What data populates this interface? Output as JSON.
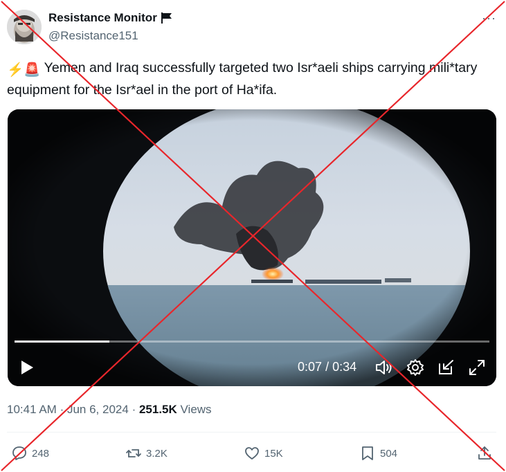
{
  "author": {
    "display_name": "Resistance Monitor",
    "handle": "@Resistance151"
  },
  "more_label": "···",
  "tweet": {
    "emoji": "⚡🚨",
    "text": " Yemen and Iraq successfully targeted two Isr*aeli ships carrying mili*tary equipment for the Isr*ael in the port of Ha*ifa."
  },
  "video": {
    "current_time": "0:07",
    "separator": "/",
    "duration": "0:34",
    "progress_fraction": 0.2
  },
  "meta": {
    "time": "10:41 AM",
    "dot1": "·",
    "date": "Jun 6, 2024",
    "dot2": "·",
    "views": "251.5K",
    "views_label": " Views"
  },
  "actions": {
    "replies": "248",
    "reposts": "3.2K",
    "likes": "15K",
    "bookmarks": "504"
  },
  "colors": {
    "text_primary": "#0f1419",
    "text_secondary": "#536471",
    "cross_mark": "#e8262b"
  }
}
